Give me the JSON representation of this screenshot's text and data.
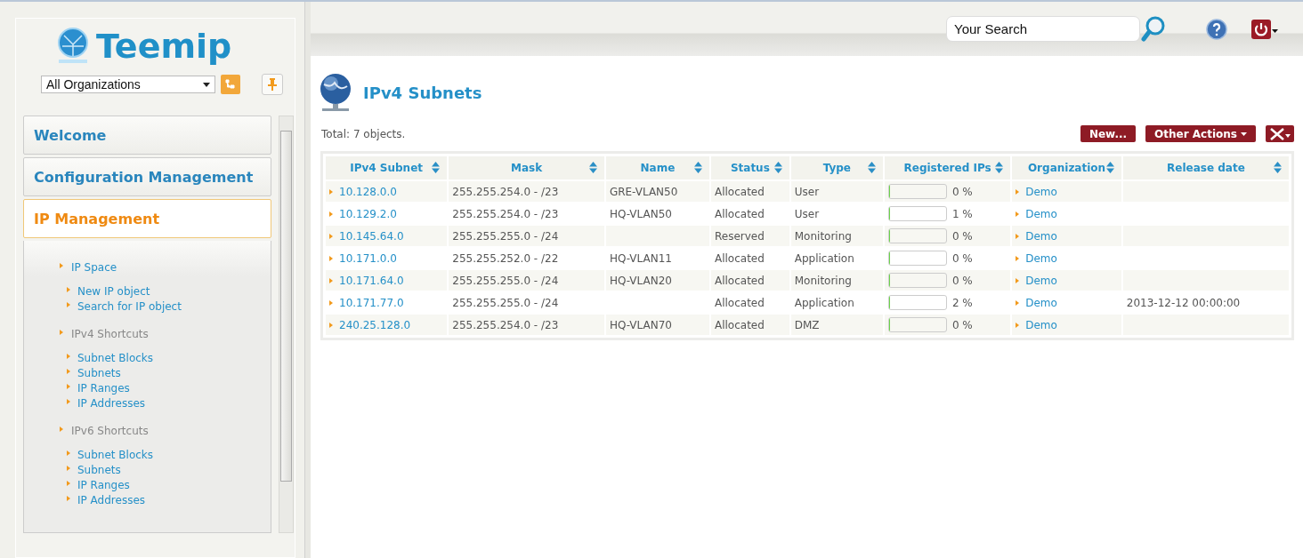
{
  "logo": {
    "text": "Teemip"
  },
  "org_select": {
    "value": "All Organizations"
  },
  "accordion": [
    {
      "label": "Welcome",
      "selected": false
    },
    {
      "label": "Configuration Management",
      "selected": false
    },
    {
      "label": "IP Management",
      "selected": true,
      "children": [
        {
          "label": "IP Space",
          "kind": "link",
          "children": [
            {
              "label": "New IP object"
            },
            {
              "label": "Search for IP object"
            }
          ]
        },
        {
          "label": "IPv4 Shortcuts",
          "kind": "heading",
          "children": [
            {
              "label": "Subnet Blocks"
            },
            {
              "label": "Subnets"
            },
            {
              "label": "IP Ranges"
            },
            {
              "label": "IP Addresses"
            }
          ]
        },
        {
          "label": "IPv6 Shortcuts",
          "kind": "heading",
          "children": [
            {
              "label": "Subnet Blocks"
            },
            {
              "label": "Subnets"
            },
            {
              "label": "IP Ranges"
            },
            {
              "label": "IP Addresses"
            }
          ]
        }
      ]
    }
  ],
  "search": {
    "value": "Your Search"
  },
  "page_title": "IPv4 Subnets",
  "total": "Total: 7 objects.",
  "buttons": [
    {
      "label": "New...",
      "kind": "plain"
    },
    {
      "label": "Other Actions",
      "kind": "menu"
    },
    {
      "kind": "tools"
    }
  ],
  "table": {
    "columns": [
      "IPv4 Subnet",
      "Mask",
      "Name",
      "Status",
      "Type",
      "Registered IPs",
      "Organization",
      "Release date"
    ],
    "rows": [
      {
        "subnet": "10.128.0.0",
        "mask": "255.255.254.0 - /23",
        "name": "GRE-VLAN50",
        "status": "Allocated",
        "type": "User",
        "level": 0,
        "percent": "0 %",
        "organization": "Demo",
        "release_date": ""
      },
      {
        "subnet": "10.129.2.0",
        "mask": "255.255.254.0 - /23",
        "name": "HQ-VLAN50",
        "status": "Allocated",
        "type": "User",
        "level": 0.01,
        "percent": "1 %",
        "organization": "Demo",
        "release_date": ""
      },
      {
        "subnet": "10.145.64.0",
        "mask": "255.255.255.0 - /24",
        "name": "",
        "status": "Reserved",
        "type": "Monitoring",
        "level": 0,
        "percent": "0 %",
        "organization": "Demo",
        "release_date": ""
      },
      {
        "subnet": "10.171.0.0",
        "mask": "255.255.252.0 - /22",
        "name": "HQ-VLAN11",
        "status": "Allocated",
        "type": "Application",
        "level": 0,
        "percent": "0 %",
        "organization": "Demo",
        "release_date": ""
      },
      {
        "subnet": "10.171.64.0",
        "mask": "255.255.255.0 - /24",
        "name": "HQ-VLAN20",
        "status": "Allocated",
        "type": "Monitoring",
        "level": 0,
        "percent": "0 %",
        "organization": "Demo",
        "release_date": ""
      },
      {
        "subnet": "10.171.77.0",
        "mask": "255.255.255.0 - /24",
        "name": "",
        "status": "Allocated",
        "type": "Application",
        "level": 0.02,
        "percent": "2 %",
        "organization": "Demo",
        "release_date": "2013-12-12 00:00:00"
      },
      {
        "subnet": "240.25.128.0",
        "mask": "255.255.254.0 - /23",
        "name": "HQ-VLAN70",
        "status": "Allocated",
        "type": "DMZ",
        "level": 0,
        "percent": "0 %",
        "organization": "Demo",
        "release_date": ""
      }
    ]
  }
}
